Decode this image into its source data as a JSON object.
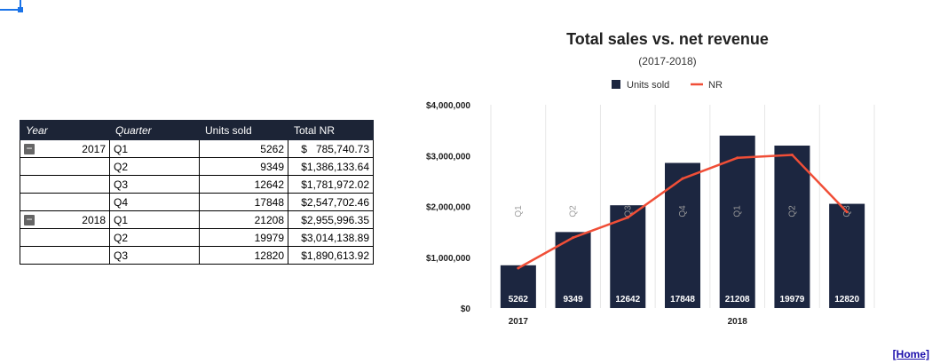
{
  "table": {
    "headers": [
      "Year",
      "Quarter",
      "Units sold",
      "Total NR"
    ],
    "rows": [
      {
        "year": "2017",
        "quarter": "Q1",
        "units": "5262",
        "nr": "$   785,740.73"
      },
      {
        "year": "",
        "quarter": "Q2",
        "units": "9349",
        "nr": "$1,386,133.64"
      },
      {
        "year": "",
        "quarter": "Q3",
        "units": "12642",
        "nr": "$1,781,972.02"
      },
      {
        "year": "",
        "quarter": "Q4",
        "units": "17848",
        "nr": "$2,547,702.46"
      },
      {
        "year": "2018",
        "quarter": "Q1",
        "units": "21208",
        "nr": "$2,955,996.35"
      },
      {
        "year": "",
        "quarter": "Q2",
        "units": "19979",
        "nr": "$3,014,138.89"
      },
      {
        "year": "",
        "quarter": "Q3",
        "units": "12820",
        "nr": "$1,890,613.92"
      }
    ],
    "collapse_symbol": "−"
  },
  "chart_data": {
    "type": "bar",
    "title": "Total sales vs. net revenue",
    "subtitle": "(2017-2018)",
    "categories": [
      "Q1",
      "Q2",
      "Q3",
      "Q4",
      "Q1",
      "Q2",
      "Q3"
    ],
    "years": [
      {
        "label": "2017",
        "index": 0
      },
      {
        "label": "2018",
        "index": 4
      }
    ],
    "series": [
      {
        "name": "Units sold",
        "type": "bar",
        "color": "#1c2640",
        "values": [
          5262,
          9349,
          12642,
          17848,
          21208,
          19979,
          12820
        ]
      },
      {
        "name": "NR",
        "type": "line",
        "color": "#f04e37",
        "values": [
          785740.73,
          1386133.64,
          1781972.02,
          2547702.46,
          2955996.35,
          3014138.89,
          1890613.92
        ]
      }
    ],
    "yticks": [
      "$0",
      "$1,000,000",
      "$2,000,000",
      "$3,000,000",
      "$4,000,000"
    ],
    "ylim": [
      0,
      4000000
    ],
    "bar_ylim": [
      0,
      25000
    ],
    "grid": true,
    "legend": "top"
  },
  "footer": {
    "home_link": "[Home]"
  }
}
